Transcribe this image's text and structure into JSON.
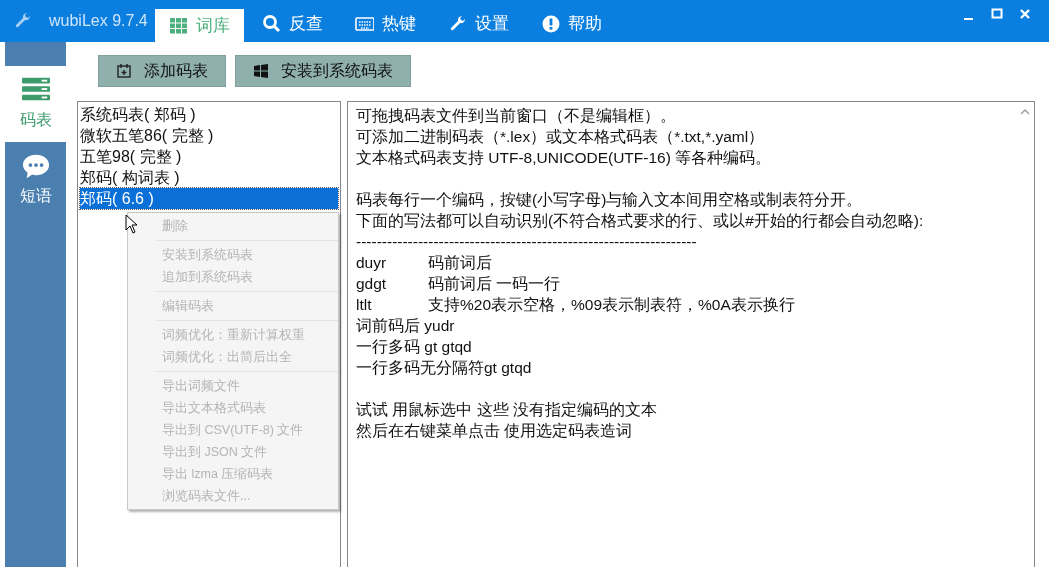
{
  "window": {
    "title": "wubiLex 9.7.4"
  },
  "tabs": [
    {
      "label": "词库",
      "selected": true
    },
    {
      "label": "反查",
      "selected": false
    },
    {
      "label": "热键",
      "selected": false
    },
    {
      "label": "设置",
      "selected": false
    },
    {
      "label": "帮助",
      "selected": false
    }
  ],
  "sidebar": {
    "items": [
      {
        "label": "码表",
        "selected": true
      },
      {
        "label": "短语",
        "selected": false
      }
    ]
  },
  "toolbar": [
    {
      "label": "添加码表"
    },
    {
      "label": "安装到系统码表"
    }
  ],
  "tables": [
    {
      "label": "系统码表( 郑码 )",
      "selected": false
    },
    {
      "label": "微软五笔86( 完整 )",
      "selected": false
    },
    {
      "label": "五笔98( 完整 )",
      "selected": false
    },
    {
      "label": "郑码( 构词表 )",
      "selected": false
    },
    {
      "label": "郑码( 6.6 )",
      "selected": true
    }
  ],
  "context_menu": [
    [
      {
        "label": "删除",
        "disabled": true
      }
    ],
    [
      {
        "label": "安装到系统码表",
        "disabled": true
      },
      {
        "label": "追加到系统码表",
        "disabled": true
      }
    ],
    [
      {
        "label": "编辑码表",
        "disabled": true
      }
    ],
    [
      {
        "label": "词频优化：重新计算权重",
        "disabled": true
      },
      {
        "label": "词频优化：出简后出全",
        "disabled": true
      }
    ],
    [
      {
        "label": "导出词频文件",
        "disabled": true
      },
      {
        "label": "导出文本格式码表",
        "disabled": true
      },
      {
        "label": "导出到 CSV(UTF-8) 文件",
        "disabled": true
      },
      {
        "label": "导出到 JSON 文件",
        "disabled": true
      },
      {
        "label": "导出 lzma 压缩码表",
        "disabled": true
      },
      {
        "label": "浏览码表文件...",
        "disabled": true
      }
    ]
  ],
  "editor": {
    "paragraphs": [
      [
        {
          "text": "可拖拽码表文件到当前窗口（不是编辑框）。"
        },
        {
          "text": "可添加二进制码表（*.lex）或文本格式码表（*.txt,*.yaml）"
        },
        {
          "text": "文本格式码表支持 UTF-8,UNICODE(UTF-16) 等各种编码。"
        }
      ],
      [
        {
          "text": "码表每行一个编码，按键(小写字母)与输入文本间用空格或制表符分开。"
        },
        {
          "text": "下面的写法都可以自动识别(不符合格式要求的行、或以#开始的行都会自动忽略):"
        },
        {
          "text": "------------------------------------------------------------------"
        },
        {
          "code": "duyr",
          "text": "码前词后"
        },
        {
          "code": "gdgt",
          "text": "码前词后 一码一行"
        },
        {
          "code": "ltlt",
          "text": "支持%20表示空格，%09表示制表符，%0A表示换行"
        },
        {
          "text": "词前码后 yudr"
        },
        {
          "text": "一行多码 gt gtqd"
        },
        {
          "text": "一行多码无分隔符gt gtqd"
        }
      ],
      [
        {
          "text": "试试 用鼠标选中 这些 没有指定编码的文本"
        },
        {
          "text": "然后在右键菜单点击 使用选定码表造词"
        }
      ]
    ]
  }
}
